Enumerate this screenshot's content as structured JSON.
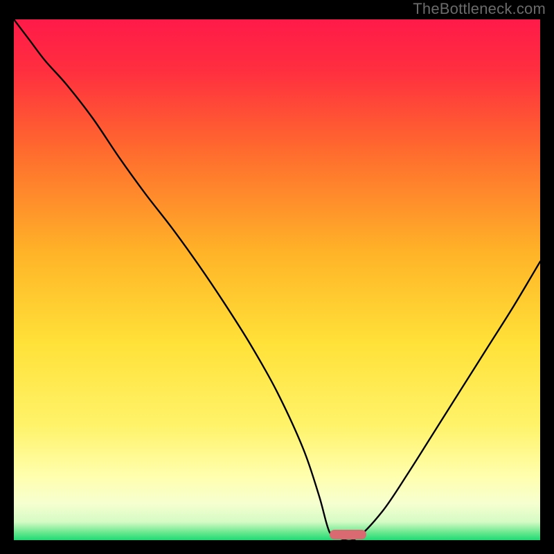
{
  "watermark": "TheBottleneck.com",
  "colors": {
    "gradient_stops": [
      {
        "offset": 0.0,
        "color": "#ff1a49"
      },
      {
        "offset": 0.1,
        "color": "#ff2f3f"
      },
      {
        "offset": 0.25,
        "color": "#ff6a2e"
      },
      {
        "offset": 0.45,
        "color": "#ffb428"
      },
      {
        "offset": 0.62,
        "color": "#ffe138"
      },
      {
        "offset": 0.78,
        "color": "#fff36a"
      },
      {
        "offset": 0.88,
        "color": "#ffffb0"
      },
      {
        "offset": 0.93,
        "color": "#f6ffd0"
      },
      {
        "offset": 0.965,
        "color": "#d5fbc4"
      },
      {
        "offset": 0.985,
        "color": "#6ae88f"
      },
      {
        "offset": 1.0,
        "color": "#1edb74"
      }
    ],
    "curve_stroke": "#000000",
    "marker_fill": "#d96a72",
    "frame_bg": "#000000"
  },
  "chart_data": {
    "type": "line",
    "title": "",
    "xlabel": "",
    "ylabel": "",
    "xlim": [
      0,
      100
    ],
    "ylim": [
      0,
      100
    ],
    "x": [
      0,
      3,
      6,
      10,
      15,
      20,
      25,
      30,
      35,
      40,
      45,
      50,
      55,
      58,
      60,
      62,
      65,
      70,
      75,
      80,
      85,
      90,
      95,
      100
    ],
    "values": [
      100,
      96,
      92,
      87.5,
      81,
      73.5,
      66.5,
      60,
      53,
      45.5,
      37.5,
      28.5,
      17.5,
      8.5,
      1.5,
      0.3,
      0.3,
      5.5,
      13,
      21,
      29,
      37,
      45,
      53.5
    ],
    "flat_segment_x": [
      60,
      66
    ],
    "marker": {
      "x_range": [
        60,
        67
      ],
      "y": 0.4,
      "height": 1.6
    }
  }
}
